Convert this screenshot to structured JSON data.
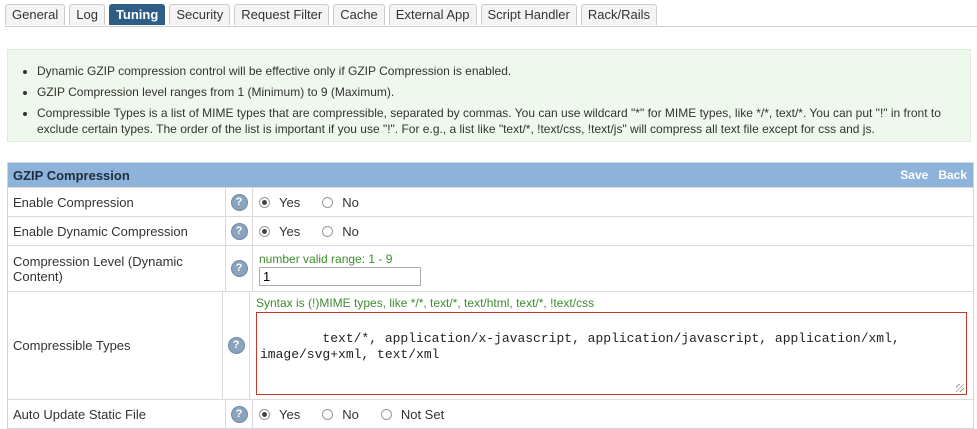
{
  "tabs": [
    {
      "label": "General",
      "active": false
    },
    {
      "label": "Log",
      "active": false
    },
    {
      "label": "Tuning",
      "active": true
    },
    {
      "label": "Security",
      "active": false
    },
    {
      "label": "Request Filter",
      "active": false
    },
    {
      "label": "Cache",
      "active": false
    },
    {
      "label": "External App",
      "active": false
    },
    {
      "label": "Script Handler",
      "active": false
    },
    {
      "label": "Rack/Rails",
      "active": false
    }
  ],
  "info": {
    "items": [
      "Dynamic GZIP compression control will be effective only if GZIP Compression is enabled.",
      "GZIP Compression level ranges from 1 (Minimum) to 9 (Maximum).",
      "Compressible Types is a list of MIME types that are compressible, separated by commas. You can use wildcard \"*\" for MIME types, like */*, text/*. You can put \"!\" in front to exclude certain types. The order of the list is important if you use \"!\". For e.g., a list like \"text/*, !text/css, !text/js\" will compress all text file except for css and js."
    ]
  },
  "section": {
    "title": "GZIP Compression",
    "save_label": "Save",
    "back_label": "Back"
  },
  "rows": {
    "enable_compression": {
      "label": "Enable Compression",
      "yes": "Yes",
      "no": "No",
      "selected": "Yes"
    },
    "enable_dynamic": {
      "label": "Enable Dynamic Compression",
      "yes": "Yes",
      "no": "No",
      "selected": "Yes"
    },
    "compression_level": {
      "label": "Compression Level (Dynamic Content)",
      "hint": "number valid range: 1 - 9",
      "value": "1"
    },
    "compressible_types": {
      "label": "Compressible Types",
      "hint": "Syntax is (!)MIME types, like */*, text/*, text/html, text/*, !text/css",
      "value": "text/*, application/x-javascript, application/javascript, application/xml, image/svg+xml, text/xml"
    },
    "auto_update": {
      "label": "Auto Update Static File",
      "yes": "Yes",
      "no": "No",
      "not_set": "Not Set",
      "selected": "Yes"
    }
  },
  "colors": {
    "active_tab": "#2e5e86",
    "section_header": "#8db3db",
    "info_bg": "#eef8ec",
    "hint_green": "#3d8c2f",
    "error_border": "#c0392b"
  }
}
